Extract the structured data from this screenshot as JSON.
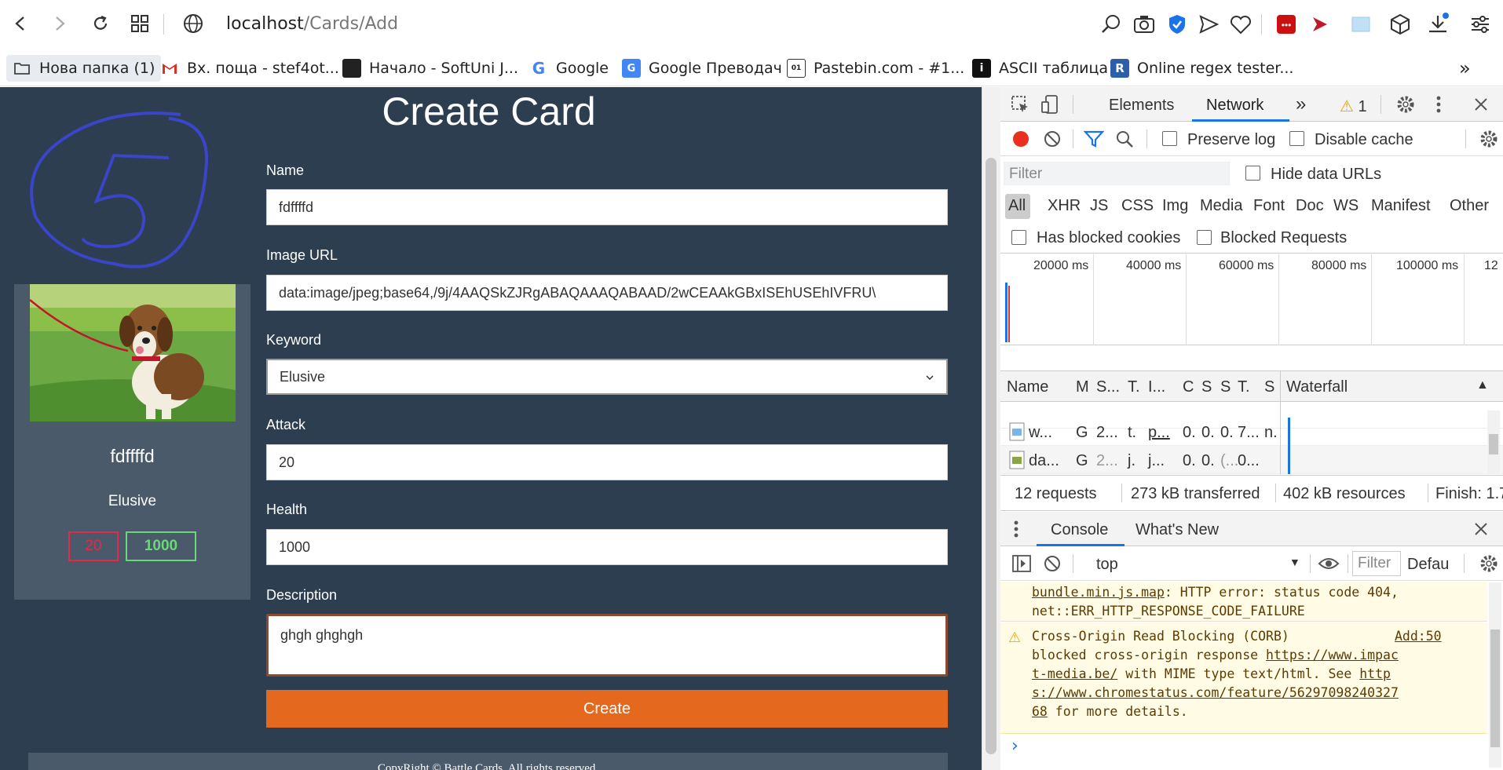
{
  "browser": {
    "url_host": "localhost",
    "url_path": "/Cards/Add",
    "bookmarks": [
      {
        "label": "Нова папка (1)",
        "icon": "folder-icon"
      },
      {
        "label": "Вх. поща - stef4ot...",
        "icon": "gmail-icon"
      },
      {
        "label": "Начало - SoftUni J...",
        "icon": "softuni-icon"
      },
      {
        "label": "Google",
        "icon": "google-icon"
      },
      {
        "label": "Google Преводач",
        "icon": "google-translate-icon"
      },
      {
        "label": "Pastebin.com - #1...",
        "icon": "pastebin-icon"
      },
      {
        "label": "ASCII таблица",
        "icon": "ascii-icon"
      },
      {
        "label": "Online regex tester...",
        "icon": "regex-icon"
      }
    ],
    "more_bookmarks": "»"
  },
  "page": {
    "title": "Create Card",
    "preview": {
      "name": "fdffffd",
      "keyword": "Elusive",
      "attack": "20",
      "health": "1000"
    },
    "form": {
      "name_label": "Name",
      "name_value": "fdffffd",
      "image_label": "Image URL",
      "image_value": "data:image/jpeg;base64,/9j/4AAQSkZJRgABAQAAAQABAAD/2wCEAAkGBxISEhUSEhIVFRU\\",
      "keyword_label": "Keyword",
      "keyword_value": "Elusive",
      "attack_label": "Attack",
      "attack_value": "20",
      "health_label": "Health",
      "health_value": "1000",
      "description_label": "Description",
      "description_value": "ghgh ghghgh",
      "create_label": "Create"
    },
    "footer": "CopyRight © Battle Cards. All rights reserved."
  },
  "devtools": {
    "tabs": {
      "elements": "Elements",
      "network": "Network",
      "more": "»",
      "warnings": "1"
    },
    "network": {
      "preserve_log": "Preserve log",
      "disable_cache": "Disable cache",
      "filter_placeholder": "Filter",
      "hide_data_urls": "Hide data URLs",
      "types": [
        "All",
        "XHR",
        "JS",
        "CSS",
        "Img",
        "Media",
        "Font",
        "Doc",
        "WS",
        "Manifest",
        "Other"
      ],
      "has_blocked_cookies": "Has blocked cookies",
      "blocked_requests": "Blocked Requests",
      "timeline_ticks": [
        "20000 ms",
        "40000 ms",
        "60000 ms",
        "80000 ms",
        "100000 ms",
        "12"
      ],
      "columns": [
        "Name",
        "M",
        "S...",
        "T.",
        "I...",
        "C",
        "S",
        "S",
        "T.",
        "S",
        "Waterfall"
      ],
      "rows": [
        {
          "name": "w...",
          "cells": [
            "G",
            "2...",
            "t.",
            "p...",
            "0.",
            "0.",
            "0.",
            "7...",
            "n."
          ],
          "icon": "image-file-icon"
        },
        {
          "name": "da...",
          "cells": [
            "G",
            "2...",
            "j.",
            "j...",
            "0.",
            "0.",
            "(...",
            "0...",
            ""
          ],
          "icon": "image-file-icon"
        }
      ],
      "summary": {
        "requests": "12 requests",
        "transferred": "273 kB transferred",
        "resources": "402 kB resources",
        "finish": "Finish: 1.7"
      }
    },
    "drawer": {
      "console_tab": "Console",
      "whats_new_tab": "What's New",
      "context": "top",
      "filter_placeholder": "Filter",
      "levels": "Defau",
      "messages": {
        "line1": "bundle.min.js.map",
        "line1b": ": HTTP error: status code 404,",
        "line2": "net::ERR_HTTP_RESPONSE_CODE_FAILURE",
        "warn1": "Cross-Origin Read Blocking (CORB)",
        "warn_src": "Add:50",
        "warn2": "blocked cross-origin response ",
        "warn2_link": "https://www.impac",
        "warn3_link": "t-media.be/",
        "warn3": " with MIME type text/html. See ",
        "warn3_link2": "http",
        "warn4_link": "s://www.chromestatus.com/feature/56297098240327",
        "warn5_link": "68",
        "warn5": " for more details."
      },
      "prompt": "›"
    }
  }
}
